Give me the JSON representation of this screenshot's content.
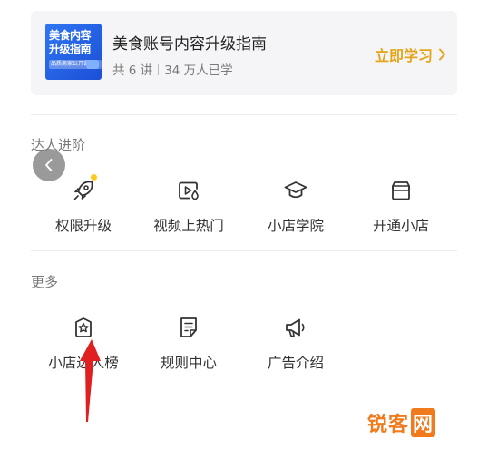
{
  "course": {
    "thumbnail_title": "美食内容升级指南",
    "thumbnail_subtitle": "品质商家公开课",
    "title": "美食账号内容升级指南",
    "lessons": "共 6 讲",
    "learners": "34 万人已学",
    "cta": "立即学习"
  },
  "sections": [
    {
      "title": "达人进阶",
      "items": [
        {
          "label": "权限升级",
          "icon": "rocket-icon",
          "has_badge": true
        },
        {
          "label": "视频上热门",
          "icon": "video-fire-icon",
          "has_badge": false
        },
        {
          "label": "小店学院",
          "icon": "graduation-cap-icon",
          "has_badge": false
        },
        {
          "label": "开通小店",
          "icon": "shop-icon",
          "has_badge": false
        }
      ]
    },
    {
      "title": "更多",
      "items": [
        {
          "label": "小店达人榜",
          "icon": "ranking-badge-icon"
        },
        {
          "label": "规则中心",
          "icon": "rules-document-icon"
        },
        {
          "label": "广告介绍",
          "icon": "megaphone-icon"
        }
      ]
    }
  ],
  "colors": {
    "accent": "#e4a51a",
    "badge": "#ffc81e",
    "annotation_arrow": "#e02020",
    "watermark": "#f07a1c"
  },
  "watermark": {
    "text": "锐客",
    "suffix": "网"
  }
}
